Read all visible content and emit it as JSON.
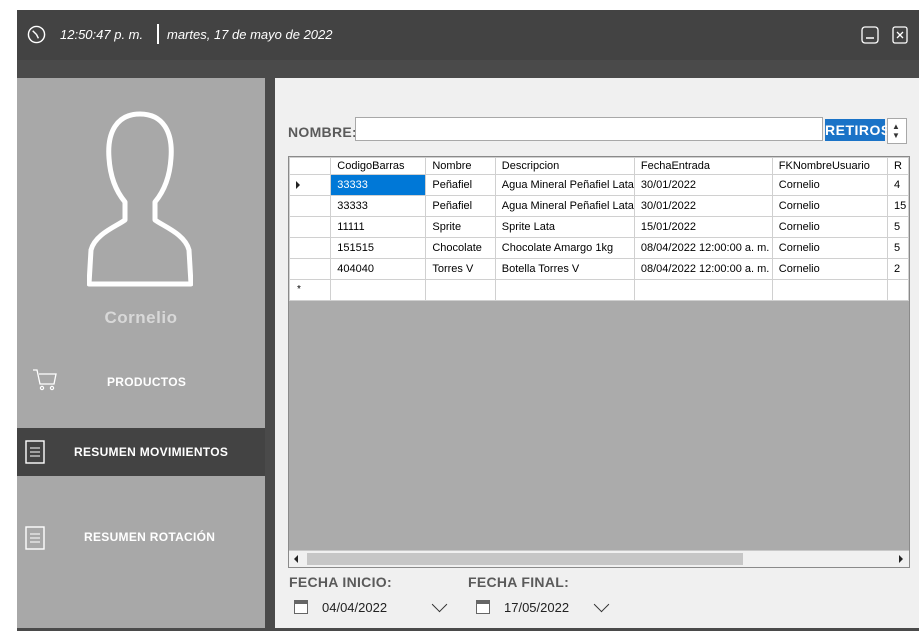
{
  "titlebar": {
    "time": "12:50:47 p. m.",
    "date": "martes, 17 de mayo de 2022",
    "icons": [
      "clock-icon",
      "minimize-icon",
      "close-icon"
    ]
  },
  "sidebar": {
    "username": "Cornelio",
    "items": [
      {
        "label": "PRODUCTOS",
        "icon": "cart-icon"
      },
      {
        "label": "RESUMEN MOVIMIENTOS",
        "icon": "document-list-icon",
        "active": true
      },
      {
        "label": "RESUMEN ROTACIÓN",
        "icon": "document-list-icon"
      }
    ]
  },
  "filter": {
    "nombre_label": "NOMBRE:",
    "nombre_value": "",
    "mode_value": "RETIROS"
  },
  "grid": {
    "columns": [
      "CodigoBarras",
      "Nombre",
      "Descripcion",
      "FechaEntrada",
      "FKNombreUsuario",
      "R"
    ],
    "rows": [
      [
        "33333",
        "Peñafiel",
        "Agua Mineral Peñafiel Lata",
        "30/01/2022",
        "Cornelio",
        "4"
      ],
      [
        "33333",
        "Peñafiel",
        "Agua Mineral Peñafiel Lata",
        "30/01/2022",
        "Cornelio",
        "15"
      ],
      [
        "11111",
        "Sprite",
        "Sprite Lata",
        "15/01/2022",
        "Cornelio",
        "5"
      ],
      [
        "151515",
        "Chocolate",
        "Chocolate Amargo 1kg",
        "08/04/2022 12:00:00 a. m.",
        "Cornelio",
        "5"
      ],
      [
        "404040",
        "Torres V",
        "Botella Torres V",
        "08/04/2022 12:00:00 a. m.",
        "Cornelio",
        "2"
      ]
    ],
    "new_row_marker": "*"
  },
  "dates": {
    "inicio_label": "FECHA INICIO:",
    "inicio_value": "04/04/2022",
    "final_label": "FECHA FINAL:",
    "final_value": "17/05/2022"
  },
  "colors": {
    "titlebar": "#434343",
    "sidebar": "#a8a8a8",
    "accent": "#1a73c7",
    "selection": "#0078d7"
  }
}
